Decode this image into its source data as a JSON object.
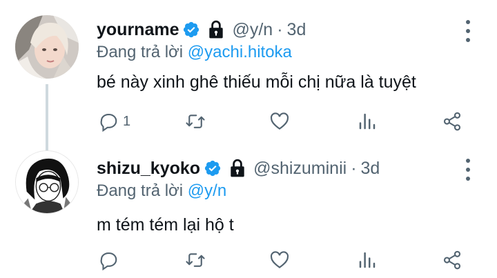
{
  "tweets": [
    {
      "display_name": "yourname",
      "handle": "@y/n",
      "separator": "·",
      "time": "3d",
      "reply_label": "Đang trả lời",
      "reply_to": "@yachi.hitoka",
      "text": "bé này xinh ghê thiếu mỗi chị nữa là tuyệt",
      "reply_count": "1",
      "retweet_count": "",
      "like_count": ""
    },
    {
      "display_name": "shizu_kyoko",
      "handle": "@shizuminii",
      "separator": "·",
      "time": "3d",
      "reply_label": "Đang trả lời",
      "reply_to": "@y/n",
      "text": "m tém tém lại hộ t",
      "reply_count": "",
      "retweet_count": "",
      "like_count": ""
    }
  ],
  "icons": {
    "verified": "verified-badge-icon",
    "protected": "lock-icon",
    "more": "more-vertical-icon",
    "reply": "reply-icon",
    "retweet": "retweet-icon",
    "like": "heart-icon",
    "analytics": "analytics-icon",
    "share": "share-icon"
  },
  "colors": {
    "accent": "#1d9bf0",
    "secondary_text": "#536471",
    "thread_line": "#cfd9de"
  }
}
